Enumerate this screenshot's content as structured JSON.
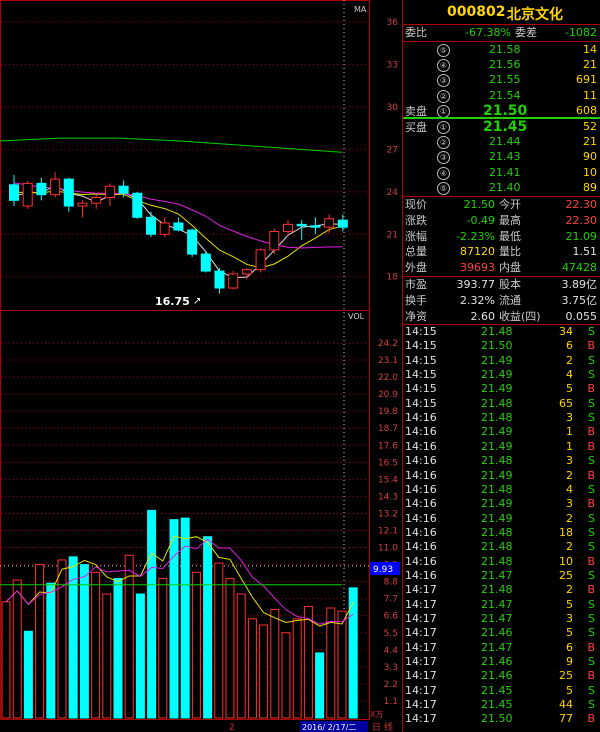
{
  "chart": {
    "ma_label": "MA",
    "vol_label": "VOL",
    "low_marker": "16.75",
    "vol_current": "9.93",
    "x_tick": "2",
    "date_label": "2016/ 2/17/二",
    "unit_label": "X万",
    "day_btn": "日",
    "line_btn": "线",
    "price_ticks": [
      "36",
      "33",
      "30",
      "27",
      "24",
      "21",
      "18"
    ],
    "vol_ticks": [
      "24.2",
      "23.1",
      "22.0",
      "20.9",
      "19.8",
      "18.7",
      "17.6",
      "16.5",
      "15.4",
      "14.3",
      "13.2",
      "12.1",
      "11.0",
      "9.9",
      "8.8",
      "7.7",
      "6.6",
      "5.5",
      "4.4",
      "3.3",
      "2.2",
      "1.1"
    ],
    "colors": {
      "up": "#ff3030",
      "down": "#00ffff",
      "ma_white": "#e0e0e0",
      "ma_yellow": "#e8e000",
      "ma_magenta": "#e020e0",
      "ma_green": "#00d000"
    }
  },
  "chart_data": [
    {
      "type": "candlestick",
      "title": "",
      "ylim": [
        16,
        37
      ],
      "ohlc": [
        [
          24.5,
          25.2,
          23.0,
          23.4
        ],
        [
          23.0,
          24.8,
          22.8,
          24.6
        ],
        [
          24.6,
          25.0,
          23.4,
          23.8
        ],
        [
          23.8,
          25.4,
          23.6,
          24.9
        ],
        [
          24.9,
          25.0,
          22.6,
          23.0
        ],
        [
          23.0,
          23.4,
          22.2,
          23.2
        ],
        [
          23.2,
          23.8,
          22.8,
          23.6
        ],
        [
          23.6,
          24.6,
          23.0,
          24.4
        ],
        [
          24.4,
          24.8,
          23.6,
          23.9
        ],
        [
          23.9,
          24.0,
          22.1,
          22.2
        ],
        [
          22.2,
          22.6,
          20.8,
          21.0
        ],
        [
          21.0,
          22.2,
          20.8,
          21.8
        ],
        [
          21.8,
          22.2,
          21.2,
          21.3
        ],
        [
          21.3,
          21.4,
          19.4,
          19.6
        ],
        [
          19.6,
          19.8,
          18.3,
          18.4
        ],
        [
          18.4,
          18.6,
          16.8,
          17.2
        ],
        [
          17.2,
          18.4,
          17.1,
          18.2
        ],
        [
          18.2,
          18.6,
          17.8,
          18.5
        ],
        [
          18.5,
          20.0,
          18.3,
          19.9
        ],
        [
          19.9,
          21.4,
          19.6,
          21.2
        ],
        [
          21.2,
          22.0,
          20.9,
          21.7
        ],
        [
          21.7,
          22.0,
          20.6,
          21.6
        ],
        [
          21.6,
          22.2,
          21.0,
          21.5
        ],
        [
          21.5,
          22.4,
          21.1,
          22.1
        ],
        [
          22.0,
          22.4,
          21.2,
          21.5
        ]
      ]
    },
    {
      "type": "bar",
      "title": "",
      "ylim": [
        0,
        25
      ],
      "values": [
        7.5,
        8.9,
        5.6,
        9.9,
        8.7,
        10.2,
        10.4,
        9.9,
        9.4,
        8.0,
        9.0,
        10.5,
        8.0,
        13.4,
        9.0,
        12.8,
        12.9,
        9.4,
        11.7,
        10.0,
        9.0,
        8.0,
        6.4,
        6.0,
        7.0,
        5.5,
        6.4,
        7.2,
        4.2,
        7.1,
        6.9,
        8.4
      ],
      "up": [
        true,
        true,
        false,
        true,
        false,
        true,
        false,
        false,
        true,
        true,
        false,
        true,
        false,
        false,
        true,
        false,
        false,
        true,
        false,
        true,
        true,
        true,
        true,
        true,
        true,
        true,
        true,
        true,
        false,
        true,
        true,
        false
      ]
    }
  ],
  "panel": {
    "code": "000802",
    "name": "北京文化",
    "webi_label": "委比",
    "webi_value": "-67.38%",
    "weicha_label": "委差",
    "weicha_value": "-1082",
    "sell_label": "卖盘",
    "buy_label": "买盘",
    "sells": [
      {
        "n": "⑤",
        "price": "21.58",
        "vol": "14"
      },
      {
        "n": "④",
        "price": "21.56",
        "vol": "21"
      },
      {
        "n": "③",
        "price": "21.55",
        "vol": "691"
      },
      {
        "n": "②",
        "price": "21.54",
        "vol": "11"
      },
      {
        "n": "①",
        "price": "21.50",
        "vol": "608"
      }
    ],
    "buys": [
      {
        "n": "①",
        "price": "21.45",
        "vol": "52"
      },
      {
        "n": "②",
        "price": "21.44",
        "vol": "21"
      },
      {
        "n": "③",
        "price": "21.43",
        "vol": "90"
      },
      {
        "n": "④",
        "price": "21.41",
        "vol": "10"
      },
      {
        "n": "⑤",
        "price": "21.40",
        "vol": "89"
      }
    ],
    "stats": [
      {
        "l1": "现价",
        "v1": "21.50",
        "c1": "green",
        "l2": "今开",
        "v2": "22.30",
        "c2": "red"
      },
      {
        "l1": "涨跌",
        "v1": "-0.49",
        "c1": "green",
        "l2": "最高",
        "v2": "22.30",
        "c2": "red"
      },
      {
        "l1": "涨幅",
        "v1": "-2.23%",
        "c1": "green",
        "l2": "最低",
        "v2": "21.09",
        "c2": "green"
      },
      {
        "l1": "总量",
        "v1": "87120",
        "c1": "yellow",
        "l2": "量比",
        "v2": "1.51",
        "c2": "white"
      },
      {
        "l1": "外盘",
        "v1": "39693",
        "c1": "red",
        "l2": "内盘",
        "v2": "47428",
        "c2": "green"
      }
    ],
    "stats2": [
      {
        "l1": "市盈",
        "v1": "393.77",
        "l2": "股本",
        "v2": "3.89亿"
      },
      {
        "l1": "换手",
        "v1": "2.32%",
        "l2": "流通",
        "v2": "3.75亿"
      },
      {
        "l1": "净资",
        "v1": "2.60",
        "l2": "收益(四)",
        "v2": "0.055"
      }
    ],
    "ticks": [
      {
        "t": "14:15",
        "p": "21.48",
        "v": "34",
        "s": "S"
      },
      {
        "t": "14:15",
        "p": "21.50",
        "v": "6",
        "s": "B"
      },
      {
        "t": "14:15",
        "p": "21.49",
        "v": "2",
        "s": "S"
      },
      {
        "t": "14:15",
        "p": "21.49",
        "v": "4",
        "s": "S"
      },
      {
        "t": "14:15",
        "p": "21.49",
        "v": "5",
        "s": "B"
      },
      {
        "t": "14:15",
        "p": "21.48",
        "v": "65",
        "s": "S"
      },
      {
        "t": "14:16",
        "p": "21.48",
        "v": "3",
        "s": "S"
      },
      {
        "t": "14:16",
        "p": "21.49",
        "v": "1",
        "s": "B"
      },
      {
        "t": "14:16",
        "p": "21.49",
        "v": "1",
        "s": "B"
      },
      {
        "t": "14:16",
        "p": "21.48",
        "v": "3",
        "s": "S"
      },
      {
        "t": "14:16",
        "p": "21.49",
        "v": "2",
        "s": "B"
      },
      {
        "t": "14:16",
        "p": "21.48",
        "v": "4",
        "s": "S"
      },
      {
        "t": "14:16",
        "p": "21.49",
        "v": "3",
        "s": "B"
      },
      {
        "t": "14:16",
        "p": "21.49",
        "v": "2",
        "s": "S"
      },
      {
        "t": "14:16",
        "p": "21.48",
        "v": "18",
        "s": "S"
      },
      {
        "t": "14:16",
        "p": "21.48",
        "v": "2",
        "s": "S"
      },
      {
        "t": "14:16",
        "p": "21.48",
        "v": "10",
        "s": "B"
      },
      {
        "t": "14:16",
        "p": "21.47",
        "v": "25",
        "s": "S"
      },
      {
        "t": "14:17",
        "p": "21.48",
        "v": "2",
        "s": "B"
      },
      {
        "t": "14:17",
        "p": "21.47",
        "v": "5",
        "s": "S"
      },
      {
        "t": "14:17",
        "p": "21.47",
        "v": "3",
        "s": "S"
      },
      {
        "t": "14:17",
        "p": "21.46",
        "v": "5",
        "s": "S"
      },
      {
        "t": "14:17",
        "p": "21.47",
        "v": "6",
        "s": "B"
      },
      {
        "t": "14:17",
        "p": "21.46",
        "v": "9",
        "s": "S"
      },
      {
        "t": "14:17",
        "p": "21.46",
        "v": "25",
        "s": "B"
      },
      {
        "t": "14:17",
        "p": "21.45",
        "v": "5",
        "s": "S"
      },
      {
        "t": "14:17",
        "p": "21.45",
        "v": "44",
        "s": "S"
      },
      {
        "t": "14:17",
        "p": "21.50",
        "v": "77",
        "s": "B"
      }
    ]
  }
}
